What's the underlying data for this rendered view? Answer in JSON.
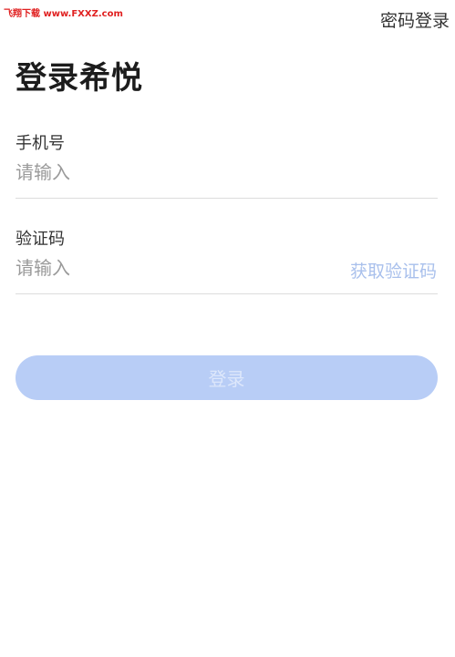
{
  "watermark": "飞翔下载 www.FXXZ.com",
  "header": {
    "password_login_link": "密码登录"
  },
  "title": "登录希悦",
  "phone_field": {
    "label": "手机号",
    "placeholder": "请输入",
    "value": ""
  },
  "code_field": {
    "label": "验证码",
    "placeholder": "请输入",
    "value": "",
    "get_code_label": "获取验证码"
  },
  "login_button": {
    "label": "登录"
  },
  "colors": {
    "accent_disabled": "#b8cdf6",
    "link_disabled": "#a9c0ec",
    "divider": "#dcdcdc"
  }
}
